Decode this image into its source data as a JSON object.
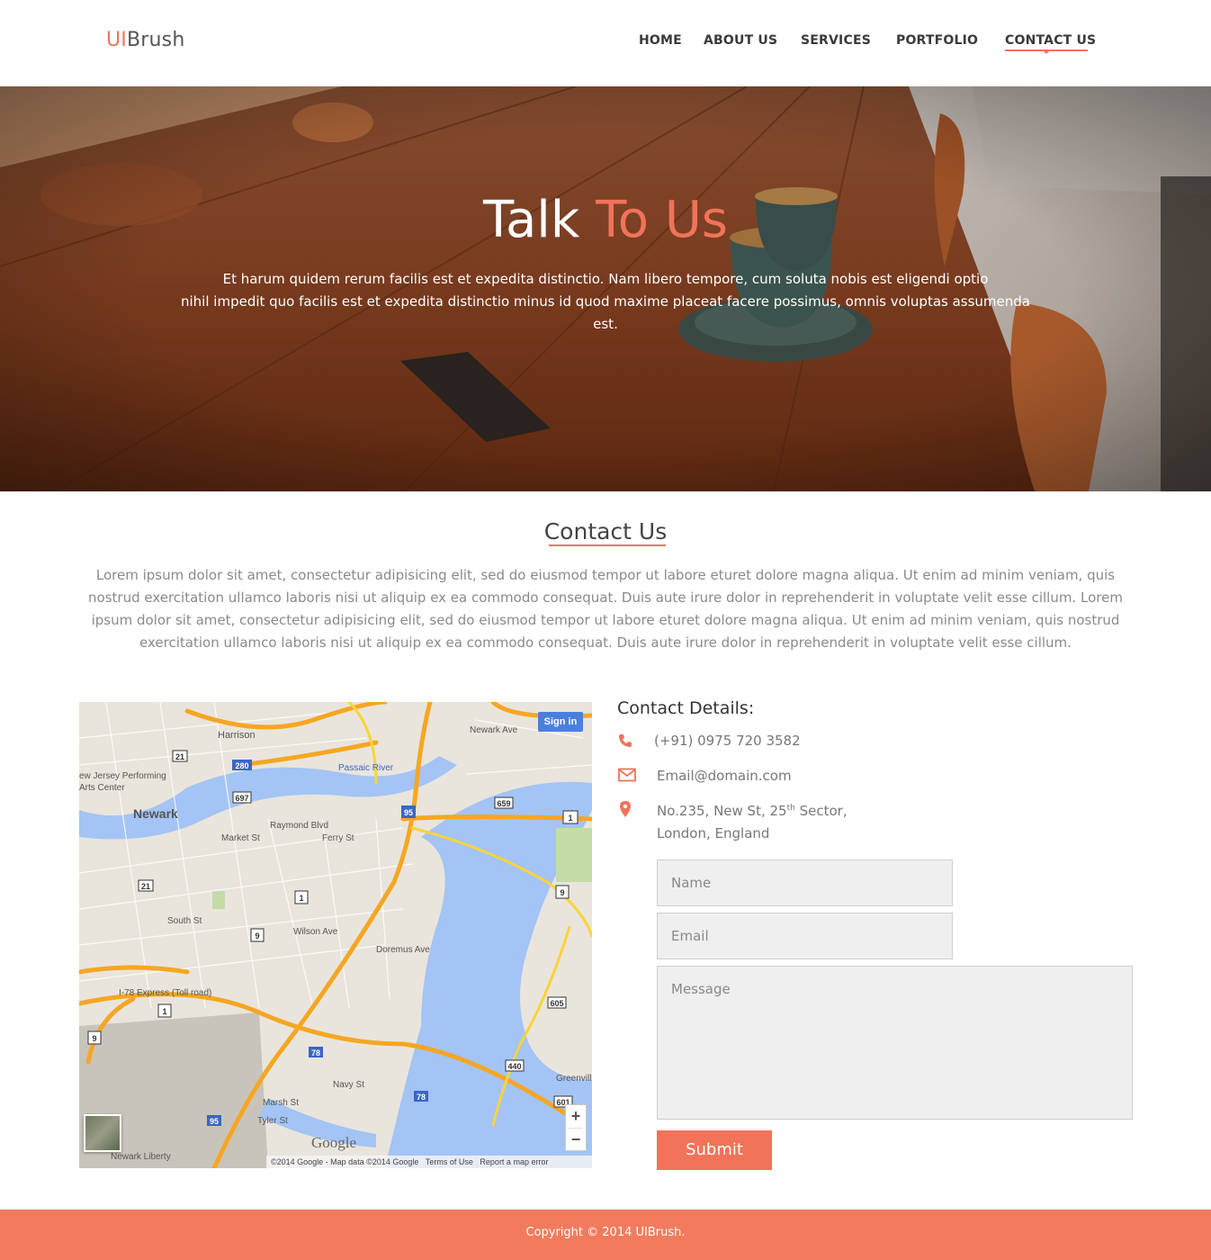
{
  "header": {
    "logo_accent": "UI",
    "logo_rest": "Brush",
    "nav": [
      {
        "label": "HOME"
      },
      {
        "label": "ABOUT US"
      },
      {
        "label": "SERVICES"
      },
      {
        "label": "PORTFOLIO"
      },
      {
        "label": "CONTACT US"
      }
    ],
    "active_nav": "CONTACT US"
  },
  "hero": {
    "title_main": "Talk ",
    "title_accent": "To Us",
    "line1": "Et harum quidem rerum facilis est et expedita distinctio. Nam libero tempore, cum soluta nobis est eligendi optio",
    "line2": "nihil impedit quo facilis est et expedita distinctio minus id quod maxime placeat facere possimus, omnis voluptas assumenda est."
  },
  "contact_section": {
    "title": "Contact Us",
    "text": "Lorem ipsum dolor sit amet, consectetur adipisicing elit, sed do eiusmod tempor  ut labore eturet dolore magna aliqua. Ut enim ad minim veniam, quis nostrud exercitation ullamco laboris nisi ut aliquip ex ea commodo consequat. Duis aute irure dolor in reprehenderit in voluptate velit esse cillum.  Lorem ipsum dolor sit amet, consectetur adipisicing elit, sed do eiusmod tempor  ut labore eturet dolore magna aliqua. Ut enim ad minim veniam, quis nostrud exercitation ullamco laboris nisi ut aliquip ex ea commodo consequat. Duis aute irure dolor in reprehenderit in voluptate velit esse cillum."
  },
  "map": {
    "sign_in": "Sign in",
    "zoom_in": "+",
    "zoom_out": "−",
    "brand": "Google",
    "attribution": "©2014 Google - Map data ©2014 Google",
    "terms": "Terms of Use",
    "report": "Report a map error",
    "labels": {
      "harrison": "Harrison",
      "newark": "Newark",
      "arts_center": "ew Jersey Performing Arts Center",
      "passaic_river": "Passaic River",
      "raymond_blvd": "Raymond Blvd",
      "ferry_st": "Ferry St",
      "market_st": "Market St",
      "south_st": "South St",
      "wilson_ave": "Wilson Ave",
      "doremus_ave": "Doremus Ave",
      "newark_ave": "Newark Ave",
      "express": "I-78 Express (Toll road)",
      "newark_liberty": "Newark Liberty",
      "greenville": "Greenvill",
      "marsh_st": "Marsh St",
      "tyler_st": "Tyler St",
      "navy_st": "Navy St"
    }
  },
  "contact_details": {
    "title": "Contact Details:",
    "phone": "(+91) 0975 720 3582",
    "email": "Email@domain.com",
    "address_line1_pre": "No.235, New St, 25",
    "address_sup": "th",
    "address_line1_post": " Sector,",
    "address_line2": "London, England",
    "icons": [
      "phone-icon",
      "envelope-icon",
      "map-marker-icon"
    ]
  },
  "form": {
    "name_placeholder": "Name",
    "email_placeholder": "Email",
    "message_placeholder": "Message",
    "submit": "Submit"
  },
  "footer": {
    "text": "Copyright © 2014 UIBrush."
  },
  "colors": {
    "accent": "#f0735a",
    "footer_bg": "#f27b5d"
  }
}
